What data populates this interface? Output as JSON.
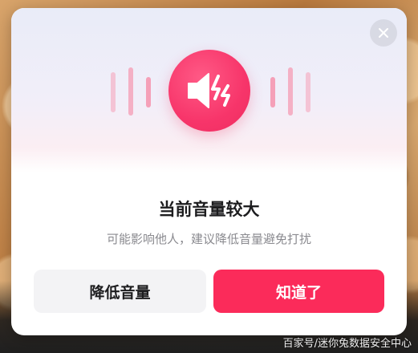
{
  "dialog": {
    "title": "当前音量较大",
    "message": "可能影响他人，建议降低音量避免打扰",
    "lower_volume_label": "降低音量",
    "acknowledge_label": "知道了"
  },
  "watermark": "百家号/迷你兔数据安全中心",
  "icons": {
    "hero": "speaker-loud-icon",
    "close": "close-icon"
  },
  "colors": {
    "accent": "#fb2b5a",
    "icon_circle": "#f7356a",
    "wave": "#f5a0b8",
    "secondary_button": "#f3f3f5"
  }
}
